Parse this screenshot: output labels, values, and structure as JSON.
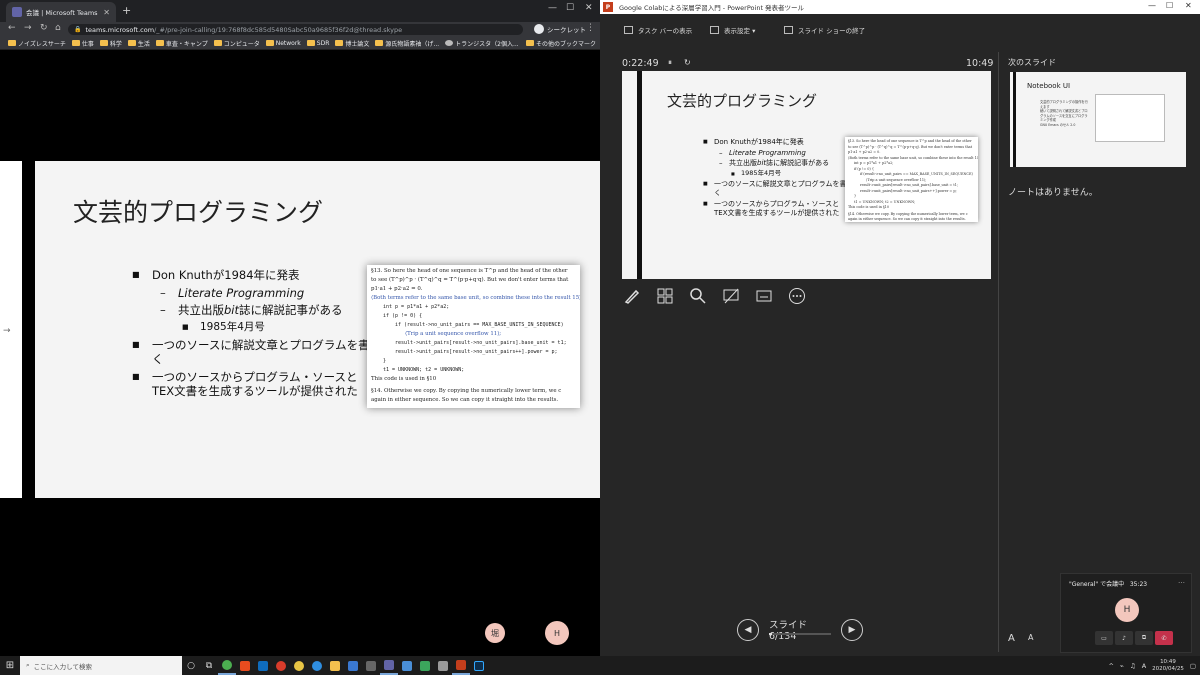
{
  "chrome": {
    "tab_title": "会議 | Microsoft Teams",
    "new_tab": "+",
    "url_host": "teams.microsoft.com",
    "url_path": "/_#/pre-join-calling/19:768f8dc585d5480Sabc50a9685f36f2d@thread.skype",
    "incognito_label": "シークレット",
    "bookmarks": [
      "ノイズレスサーチ",
      "仕事",
      "科学",
      "生活",
      "車査・キャンプ",
      "コンピュータ",
      "Network",
      "SDR",
      "博士論文",
      "源氏物語素袖（げ...",
      "トランジスタ（2個入..."
    ],
    "other_bookmarks": "その他のブックマーク"
  },
  "slide": {
    "title": "文芸的プログラミング",
    "bullet1": "Don Knuthが1984年に発表",
    "sub1": "Literate Programming",
    "sub2_a": "共立出版",
    "sub2_b": "bit",
    "sub2_c": "誌に解説記事がある",
    "subsub": "1985年4月号",
    "bullet2": "一つのソースに解説文章とプログラムを書く",
    "bullet3": "一つのソースからプログラム・ソースとTEX文書を生成するツールが提供された",
    "tex_lines": [
      "§13.  So here the head of one sequence is T^p and the head of the other",
      "to see (T^p)^p · (T^q)^q = T^(p·p+q·q). But we don't enter terms that",
      "p1·a1 + p2·a2 = 0.",
      "⟨Both terms refer to the same base unit, so combine these into the result 15⟩ ≡",
      "int p = p1*a1 + p2*a2;",
      "if (p != 0) {",
      "if (result->no_unit_pairs == MAX_BASE_UNITS_IN_SEQUENCE)",
      "⟨Trip a unit sequence overflow 11⟩;",
      "result->unit_pairs[result->no_unit_pairs].base_unit = t1;",
      "result->unit_pairs[result->no_unit_pairs++].power = p;",
      "}",
      "t1 = UNKNOWN; t2 = UNKNOWN;",
      "This code is used in §10",
      "§14.  Otherwise we copy. By copying the numerically lower term, we c",
      "again in either sequence. So we can copy it straight into the results."
    ]
  },
  "teams": {
    "avatar1": "堀",
    "avatar2": "H"
  },
  "ppt": {
    "window_title": "Google Colabによる深層学習入門 - PowerPoint 発表者ツール",
    "toolbar": {
      "taskbar": "タスク バーの表示",
      "display": "表示設定 ▾",
      "end_show": "スライド ショーの終了"
    },
    "timer": "0:22:49",
    "clock": "10:49",
    "next_slide_label": "次のスライド",
    "next_slide_title": "Notebook UI",
    "next_slide_lines": [
      "文芸的プログラミングの操作を行えます",
      "続いて説明されて解説文書とプログラムのソースを交互にプログラミング作成",
      "GNU Emacs のセル 2.0"
    ],
    "notes": "ノートはありません。",
    "slide_counter": "スライド 6/134",
    "slide_progress": 0.045,
    "font_up": "A",
    "font_down": "A"
  },
  "call": {
    "header": "\"General\" で会議中",
    "duration": "35:23",
    "avatar": "H"
  },
  "taskbar": {
    "search_placeholder": "ここに入力して検索",
    "time": "10:49",
    "date": "2020/04/25"
  }
}
